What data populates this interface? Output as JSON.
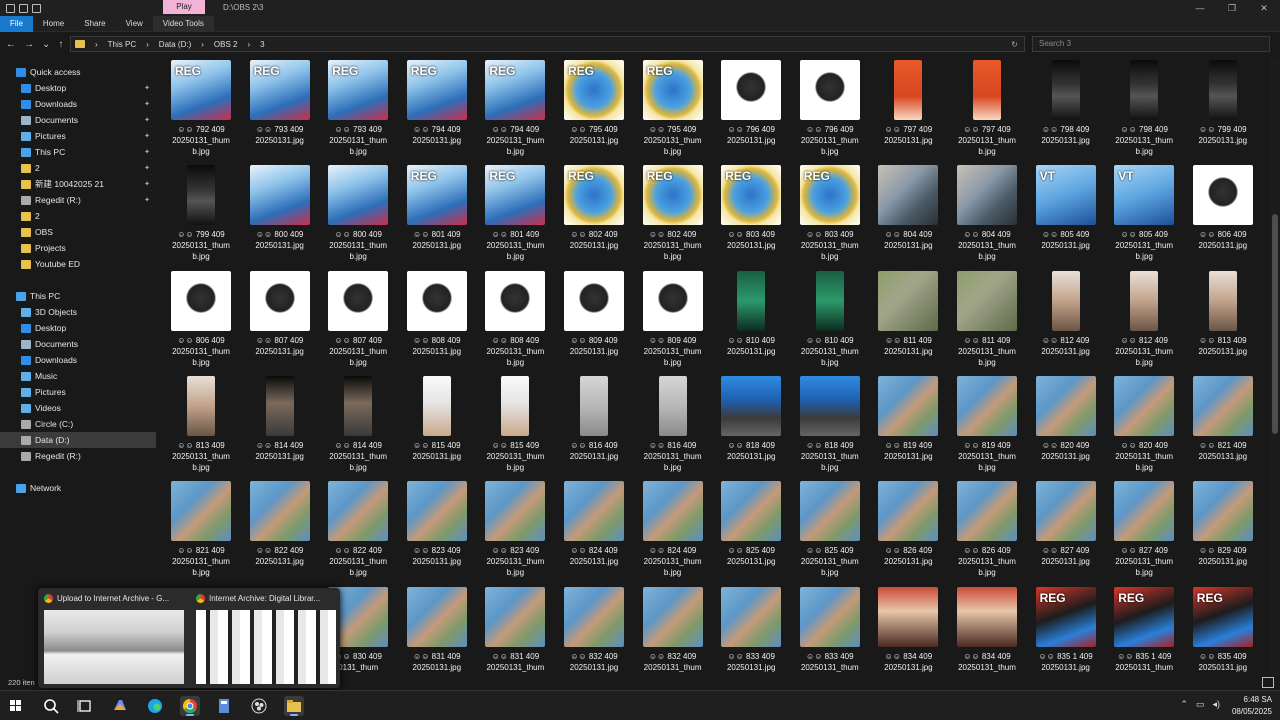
{
  "window": {
    "title": "D:\\OBS 2\\3",
    "context_tab": "Play",
    "controls": [
      "—",
      "❐",
      "✕"
    ]
  },
  "ribbon": {
    "tabs": [
      {
        "label": "File"
      },
      {
        "label": "Home"
      },
      {
        "label": "Share"
      },
      {
        "label": "View"
      },
      {
        "label": "Video Tools"
      }
    ]
  },
  "address": {
    "crumbs": [
      "This PC",
      "Data (D:)",
      "OBS 2",
      "3"
    ],
    "search_placeholder": "Search 3"
  },
  "sidebar": {
    "items": [
      {
        "label": "Quick access",
        "icon": "star-icon",
        "color": "#2f8fe8",
        "indent": 1,
        "pin": false
      },
      {
        "label": "Desktop",
        "icon": "desktop-icon",
        "color": "#2f8fe8",
        "indent": 2,
        "pin": true
      },
      {
        "label": "Downloads",
        "icon": "download-icon",
        "color": "#2f8fe8",
        "indent": 2,
        "pin": true
      },
      {
        "label": "Documents",
        "icon": "document-icon",
        "color": "#9fb3c8",
        "indent": 2,
        "pin": true
      },
      {
        "label": "Pictures",
        "icon": "picture-icon",
        "color": "#5fb0e8",
        "indent": 2,
        "pin": true
      },
      {
        "label": "This PC",
        "icon": "computer-icon",
        "color": "#4aa3e8",
        "indent": 2,
        "pin": true
      },
      {
        "label": "2",
        "icon": "folder-icon",
        "color": "#e8c14e",
        "indent": 2,
        "pin": true
      },
      {
        "label": "新建 10042025 21",
        "icon": "folder-icon",
        "color": "#e8c14e",
        "indent": 2,
        "pin": true
      },
      {
        "label": "Regedit (R:)",
        "icon": "drive-icon",
        "color": "#aaaaaa",
        "indent": 2,
        "pin": true
      },
      {
        "label": "2",
        "icon": "folder-icon",
        "color": "#e8c14e",
        "indent": 2,
        "pin": false
      },
      {
        "label": "OBS",
        "icon": "folder-icon",
        "color": "#e8c14e",
        "indent": 2,
        "pin": false
      },
      {
        "label": "Projects",
        "icon": "folder-icon",
        "color": "#e8c14e",
        "indent": 2,
        "pin": false
      },
      {
        "label": "Youtube ED",
        "icon": "folder-icon",
        "color": "#e8c14e",
        "indent": 2,
        "pin": false
      },
      {
        "label": "",
        "icon": "",
        "color": "",
        "indent": 0,
        "pin": false
      },
      {
        "label": "This PC",
        "icon": "computer-icon",
        "color": "#4aa3e8",
        "indent": 1,
        "pin": false
      },
      {
        "label": "3D Objects",
        "icon": "cube-icon",
        "color": "#5fb0e8",
        "indent": 2,
        "pin": false
      },
      {
        "label": "Desktop",
        "icon": "desktop-icon",
        "color": "#2f8fe8",
        "indent": 2,
        "pin": false
      },
      {
        "label": "Documents",
        "icon": "document-icon",
        "color": "#9fb3c8",
        "indent": 2,
        "pin": false
      },
      {
        "label": "Downloads",
        "icon": "download-icon",
        "color": "#2f8fe8",
        "indent": 2,
        "pin": false
      },
      {
        "label": "Music",
        "icon": "music-icon",
        "color": "#5fb0e8",
        "indent": 2,
        "pin": false
      },
      {
        "label": "Pictures",
        "icon": "picture-icon",
        "color": "#5fb0e8",
        "indent": 2,
        "pin": false
      },
      {
        "label": "Videos",
        "icon": "video-icon",
        "color": "#5fb0e8",
        "indent": 2,
        "pin": false
      },
      {
        "label": "Circle (C:)",
        "icon": "drive-icon",
        "color": "#aaaaaa",
        "indent": 2,
        "pin": false
      },
      {
        "label": "Data (D:)",
        "icon": "drive-icon",
        "color": "#aaaaaa",
        "indent": 2,
        "pin": false,
        "selected": true
      },
      {
        "label": "Regedit (R:)",
        "icon": "drive-icon",
        "color": "#aaaaaa",
        "indent": 2,
        "pin": false
      },
      {
        "label": "",
        "icon": "",
        "color": "",
        "indent": 0,
        "pin": false
      },
      {
        "label": "Network",
        "icon": "network-icon",
        "color": "#4aa3e8",
        "indent": 1,
        "pin": false
      }
    ]
  },
  "files": [
    [
      {
        "l1": "792 409",
        "l2": "20250131_thum",
        "l3": "b.jpg",
        "t": "blue",
        "reg": "REG"
      },
      {
        "l1": "793 409",
        "l2": "20250131.jpg",
        "l3": "",
        "t": "blue",
        "reg": "REG"
      },
      {
        "l1": "793 409",
        "l2": "20250131_thum",
        "l3": "b.jpg",
        "t": "blue",
        "reg": "REG"
      },
      {
        "l1": "794 409",
        "l2": "20250131.jpg",
        "l3": "",
        "t": "blue",
        "reg": "REG"
      },
      {
        "l1": "794 409",
        "l2": "20250131_thum",
        "l3": "b.jpg",
        "t": "blue",
        "reg": "REG"
      },
      {
        "l1": "795 409",
        "l2": "20250131.jpg",
        "l3": "",
        "t": "gold",
        "reg": "REG"
      },
      {
        "l1": "795 409",
        "l2": "20250131_thum",
        "l3": "b.jpg",
        "t": "gold",
        "reg": "REG"
      },
      {
        "l1": "796 409",
        "l2": "20250131.jpg",
        "l3": "",
        "t": "robot",
        "reg": ""
      },
      {
        "l1": "796 409",
        "l2": "20250131_thum",
        "l3": "b.jpg",
        "t": "robot",
        "reg": ""
      },
      {
        "l1": "797 409",
        "l2": "20250131.jpg",
        "l3": "",
        "t": "orange",
        "reg": "",
        "narrow": true
      },
      {
        "l1": "797 409",
        "l2": "20250131_thum",
        "l3": "b.jpg",
        "t": "orange",
        "reg": "",
        "narrow": true
      },
      {
        "l1": "798 409",
        "l2": "20250131.jpg",
        "l3": "",
        "t": "dark",
        "reg": "",
        "narrow": true
      },
      {
        "l1": "798 409",
        "l2": "20250131_thum",
        "l3": "b.jpg",
        "t": "dark",
        "reg": "",
        "narrow": true
      },
      {
        "l1": "799 409",
        "l2": "20250131.jpg",
        "l3": "",
        "t": "dark",
        "reg": "",
        "narrow": true
      }
    ],
    [
      {
        "l1": "799 409",
        "l2": "20250131_thum",
        "l3": "b.jpg",
        "t": "dark",
        "reg": "",
        "narrow": true
      },
      {
        "l1": "800 409",
        "l2": "20250131.jpg",
        "l3": "",
        "t": "blue",
        "reg": ""
      },
      {
        "l1": "800 409",
        "l2": "20250131_thum",
        "l3": "b.jpg",
        "t": "blue",
        "reg": ""
      },
      {
        "l1": "801 409",
        "l2": "20250131.jpg",
        "l3": "",
        "t": "blue",
        "reg": "REG"
      },
      {
        "l1": "801 409",
        "l2": "20250131_thum",
        "l3": "b.jpg",
        "t": "blue",
        "reg": "REG"
      },
      {
        "l1": "802 409",
        "l2": "20250131.jpg",
        "l3": "",
        "t": "gold",
        "reg": "REG"
      },
      {
        "l1": "802 409",
        "l2": "20250131_thum",
        "l3": "b.jpg",
        "t": "gold",
        "reg": "REG"
      },
      {
        "l1": "803 409",
        "l2": "20250131.jpg",
        "l3": "",
        "t": "gold",
        "reg": "REG"
      },
      {
        "l1": "803 409",
        "l2": "20250131_thum",
        "l3": "b.jpg",
        "t": "gold",
        "reg": "REG"
      },
      {
        "l1": "804 409",
        "l2": "20250131.jpg",
        "l3": "",
        "t": "people",
        "reg": ""
      },
      {
        "l1": "804 409",
        "l2": "20250131_thum",
        "l3": "b.jpg",
        "t": "people",
        "reg": ""
      },
      {
        "l1": "805 409",
        "l2": "20250131.jpg",
        "l3": "",
        "t": "vt",
        "reg": "VT"
      },
      {
        "l1": "805 409",
        "l2": "20250131_thum",
        "l3": "b.jpg",
        "t": "vt",
        "reg": "VT"
      },
      {
        "l1": "806 409",
        "l2": "20250131.jpg",
        "l3": "",
        "t": "robot",
        "reg": ""
      }
    ],
    [
      {
        "l1": "806 409",
        "l2": "20250131_thum",
        "l3": "b.jpg",
        "t": "robot",
        "reg": ""
      },
      {
        "l1": "807 409",
        "l2": "20250131.jpg",
        "l3": "",
        "t": "robot",
        "reg": ""
      },
      {
        "l1": "807 409",
        "l2": "20250131_thum",
        "l3": "b.jpg",
        "t": "robot",
        "reg": ""
      },
      {
        "l1": "808 409",
        "l2": "20250131.jpg",
        "l3": "",
        "t": "robot",
        "reg": ""
      },
      {
        "l1": "808 409",
        "l2": "20250131_thum",
        "l3": "b.jpg",
        "t": "robot",
        "reg": ""
      },
      {
        "l1": "809 409",
        "l2": "20250131.jpg",
        "l3": "",
        "t": "robot",
        "reg": ""
      },
      {
        "l1": "809 409",
        "l2": "20250131_thum",
        "l3": "b.jpg",
        "t": "robot",
        "reg": ""
      },
      {
        "l1": "810 409",
        "l2": "20250131.jpg",
        "l3": "",
        "t": "green",
        "reg": "",
        "narrow": true
      },
      {
        "l1": "810 409",
        "l2": "20250131_thum",
        "l3": "b.jpg",
        "t": "green",
        "reg": "",
        "narrow": true
      },
      {
        "l1": "811 409",
        "l2": "20250131.jpg",
        "l3": "",
        "t": "plant",
        "reg": ""
      },
      {
        "l1": "811 409",
        "l2": "20250131_thum",
        "l3": "b.jpg",
        "t": "plant",
        "reg": ""
      },
      {
        "l1": "812 409",
        "l2": "20250131.jpg",
        "l3": "",
        "t": "room",
        "reg": "",
        "narrow": true
      },
      {
        "l1": "812 409",
        "l2": "20250131_thum",
        "l3": "b.jpg",
        "t": "room",
        "reg": "",
        "narrow": true
      },
      {
        "l1": "813 409",
        "l2": "20250131.jpg",
        "l3": "",
        "t": "room",
        "reg": "",
        "narrow": true
      }
    ],
    [
      {
        "l1": "813 409",
        "l2": "20250131_thum",
        "l3": "b.jpg",
        "t": "room",
        "reg": "",
        "narrow": true
      },
      {
        "l1": "814 409",
        "l2": "20250131.jpg",
        "l3": "",
        "t": "phone",
        "reg": "",
        "narrow": true
      },
      {
        "l1": "814 409",
        "l2": "20250131_thum",
        "l3": "b.jpg",
        "t": "phone",
        "reg": "",
        "narrow": true
      },
      {
        "l1": "815 409",
        "l2": "20250131.jpg",
        "l3": "",
        "t": "white",
        "reg": "",
        "narrow": true
      },
      {
        "l1": "815 409",
        "l2": "20250131_thum",
        "l3": "b.jpg",
        "t": "white",
        "reg": "",
        "narrow": true
      },
      {
        "l1": "816 409",
        "l2": "20250131.jpg",
        "l3": "",
        "t": "grey",
        "reg": "",
        "narrow": true
      },
      {
        "l1": "816 409",
        "l2": "20250131_thum",
        "l3": "b.jpg",
        "t": "grey",
        "reg": "",
        "narrow": true
      },
      {
        "l1": "818 409",
        "l2": "20250131.jpg",
        "l3": "",
        "t": "desk",
        "reg": ""
      },
      {
        "l1": "818 409",
        "l2": "20250131_thum",
        "l3": "b.jpg",
        "t": "desk",
        "reg": ""
      },
      {
        "l1": "819 409",
        "l2": "20250131.jpg",
        "l3": "",
        "t": "money",
        "reg": ""
      },
      {
        "l1": "819 409",
        "l2": "20250131_thum",
        "l3": "b.jpg",
        "t": "money",
        "reg": ""
      },
      {
        "l1": "820 409",
        "l2": "20250131.jpg",
        "l3": "",
        "t": "money",
        "reg": ""
      },
      {
        "l1": "820 409",
        "l2": "20250131_thum",
        "l3": "b.jpg",
        "t": "money",
        "reg": ""
      },
      {
        "l1": "821 409",
        "l2": "20250131.jpg",
        "l3": "",
        "t": "money",
        "reg": ""
      }
    ],
    [
      {
        "l1": "821 409",
        "l2": "20250131_thum",
        "l3": "b.jpg",
        "t": "money",
        "reg": ""
      },
      {
        "l1": "822 409",
        "l2": "20250131.jpg",
        "l3": "",
        "t": "money",
        "reg": ""
      },
      {
        "l1": "822 409",
        "l2": "20250131_thum",
        "l3": "b.jpg",
        "t": "money",
        "reg": ""
      },
      {
        "l1": "823 409",
        "l2": "20250131.jpg",
        "l3": "",
        "t": "money",
        "reg": ""
      },
      {
        "l1": "823 409",
        "l2": "20250131_thum",
        "l3": "b.jpg",
        "t": "money",
        "reg": ""
      },
      {
        "l1": "824 409",
        "l2": "20250131.jpg",
        "l3": "",
        "t": "money",
        "reg": ""
      },
      {
        "l1": "824 409",
        "l2": "20250131_thum",
        "l3": "b.jpg",
        "t": "money",
        "reg": ""
      },
      {
        "l1": "825 409",
        "l2": "20250131.jpg",
        "l3": "",
        "t": "money",
        "reg": ""
      },
      {
        "l1": "825 409",
        "l2": "20250131_thum",
        "l3": "b.jpg",
        "t": "money",
        "reg": ""
      },
      {
        "l1": "826 409",
        "l2": "20250131.jpg",
        "l3": "",
        "t": "money",
        "reg": ""
      },
      {
        "l1": "826 409",
        "l2": "20250131_thum",
        "l3": "b.jpg",
        "t": "money",
        "reg": ""
      },
      {
        "l1": "827 409",
        "l2": "20250131.jpg",
        "l3": "",
        "t": "money",
        "reg": ""
      },
      {
        "l1": "827 409",
        "l2": "20250131_thum",
        "l3": "b.jpg",
        "t": "money",
        "reg": ""
      },
      {
        "l1": "829 409",
        "l2": "20250131.jpg",
        "l3": "",
        "t": "money",
        "reg": ""
      }
    ],
    [
      {
        "l1": "",
        "l2": "",
        "l3": "",
        "t": "money",
        "reg": "",
        "hidden": true
      },
      {
        "l1": "",
        "l2": "",
        "l3": "",
        "t": "money",
        "reg": "",
        "hidden": true
      },
      {
        "l1": "830 409",
        "l2": "0131_thum",
        "l3": "",
        "t": "money",
        "reg": ""
      },
      {
        "l1": "831 409",
        "l2": "20250131.jpg",
        "l3": "",
        "t": "money",
        "reg": ""
      },
      {
        "l1": "831 409",
        "l2": "20250131_thum",
        "l3": "",
        "t": "money",
        "reg": ""
      },
      {
        "l1": "832 409",
        "l2": "20250131.jpg",
        "l3": "",
        "t": "money",
        "reg": ""
      },
      {
        "l1": "832 409",
        "l2": "20250131_thum",
        "l3": "",
        "t": "money",
        "reg": ""
      },
      {
        "l1": "833 409",
        "l2": "20250131.jpg",
        "l3": "",
        "t": "money",
        "reg": ""
      },
      {
        "l1": "833 409",
        "l2": "20250131_thum",
        "l3": "",
        "t": "money",
        "reg": ""
      },
      {
        "l1": "834 409",
        "l2": "20250131.jpg",
        "l3": "",
        "t": "face",
        "reg": ""
      },
      {
        "l1": "834 409",
        "l2": "20250131_thum",
        "l3": "",
        "t": "face",
        "reg": ""
      },
      {
        "l1": "835 1 409",
        "l2": "20250131.jpg",
        "l3": "",
        "t": "regred",
        "reg": "REG"
      },
      {
        "l1": "835 1 409",
        "l2": "20250131_thum",
        "l3": "",
        "t": "regred",
        "reg": "REG"
      },
      {
        "l1": "835 409",
        "l2": "20250131.jpg",
        "l3": "",
        "t": "regred",
        "reg": "REG"
      }
    ]
  ],
  "file_prefix": "☺☺",
  "status": {
    "count": "220 iten"
  },
  "preview": {
    "items": [
      {
        "title": "Upload to Internet Archive - G..."
      },
      {
        "title": "Internet Archive: Digital Librar..."
      }
    ]
  },
  "taskbar": {
    "time": "6:48 SA",
    "date": "08/05/2025"
  }
}
